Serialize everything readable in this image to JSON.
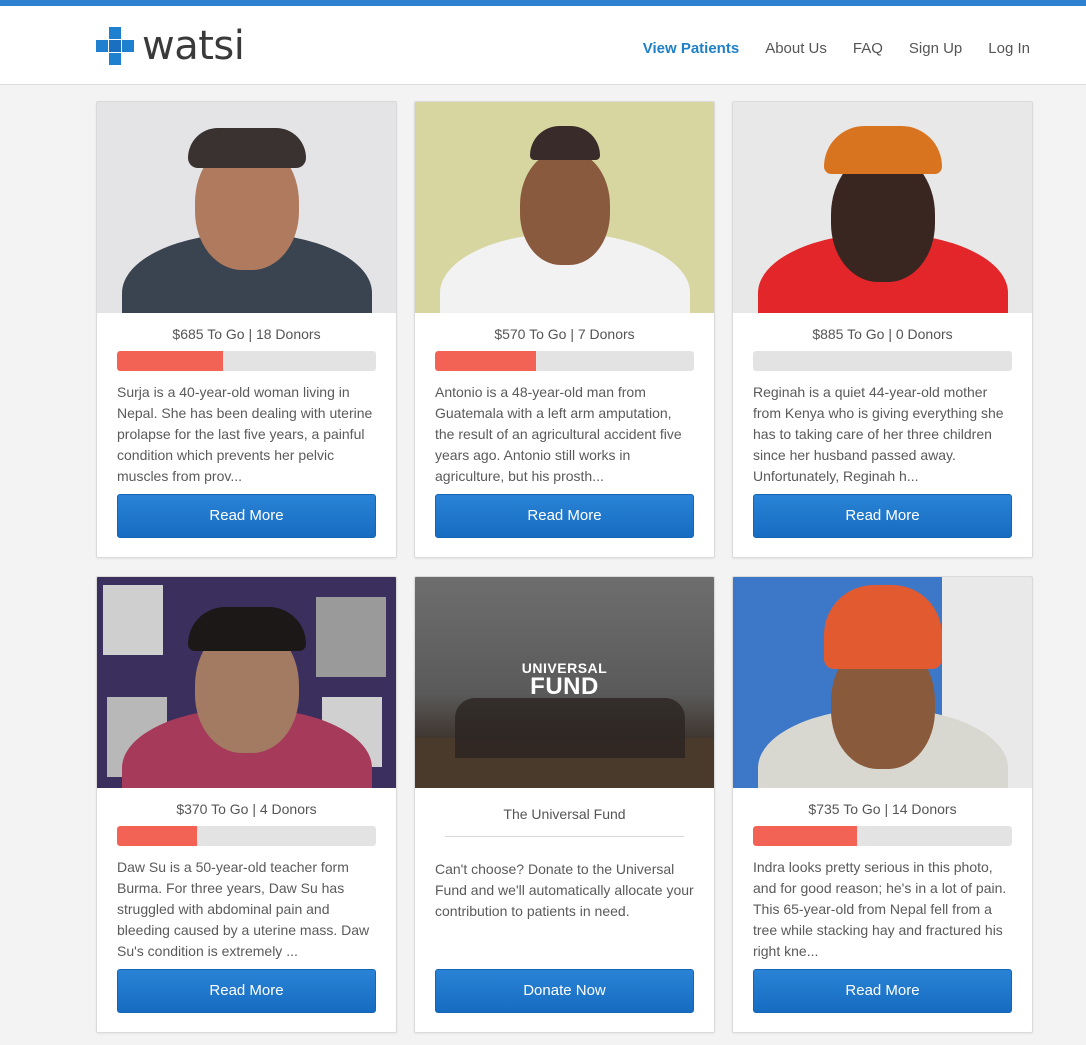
{
  "brand": {
    "name": "watsi",
    "accent": "#2080d0"
  },
  "nav": {
    "items": [
      {
        "label": "View Patients",
        "active": true
      },
      {
        "label": "About Us",
        "active": false
      },
      {
        "label": "FAQ",
        "active": false
      },
      {
        "label": "Sign Up",
        "active": false
      },
      {
        "label": "Log In",
        "active": false
      }
    ]
  },
  "cards": [
    {
      "stat": "$685 To Go | 18 Donors",
      "progress": 0.41,
      "description": "Surja is a 40-year-old woman living in Nepal. She has been dealing with uterine prolapse for the last five years, a painful condition which prevents her pelvic muscles from prov...",
      "button": "Read More"
    },
    {
      "stat": "$570 To Go | 7 Donors",
      "progress": 0.39,
      "description": "Antonio is a 48-year-old man from Guatemala with a left arm amputation, the result of an agricultural accident five years ago. Antonio still works in agriculture, but his prosth...",
      "button": "Read More"
    },
    {
      "stat": "$885 To Go | 0 Donors",
      "progress": 0,
      "description": "Reginah is a quiet 44-year-old mother from Kenya who is giving everything she has to taking care of her three children since her husband passed away. Unfortunately, Reginah h...",
      "button": "Read More"
    },
    {
      "stat": "$370 To Go | 4 Donors",
      "progress": 0.31,
      "description": "Daw Su is a 50-year-old teacher form Burma. For three years, Daw Su has struggled with abdominal pain and bleeding caused by a uterine mass. Daw Su's condition is extremely ...",
      "button": "Read More"
    },
    {
      "fund_logo_line1": "UNIVERSAL",
      "fund_logo_line2": "FUND",
      "title": "The Universal Fund",
      "description": "Can't choose? Donate to the Universal Fund and we'll automatically allocate your contribution to patients in need.",
      "button": "Donate Now"
    },
    {
      "stat": "$735 To Go | 14 Donors",
      "progress": 0.4,
      "description": "Indra looks pretty serious in this photo, and for good reason; he's in a lot of pain. This 65-year-old from Nepal fell from a tree while stacking hay and fractured his right kne...",
      "button": "Read More"
    }
  ]
}
